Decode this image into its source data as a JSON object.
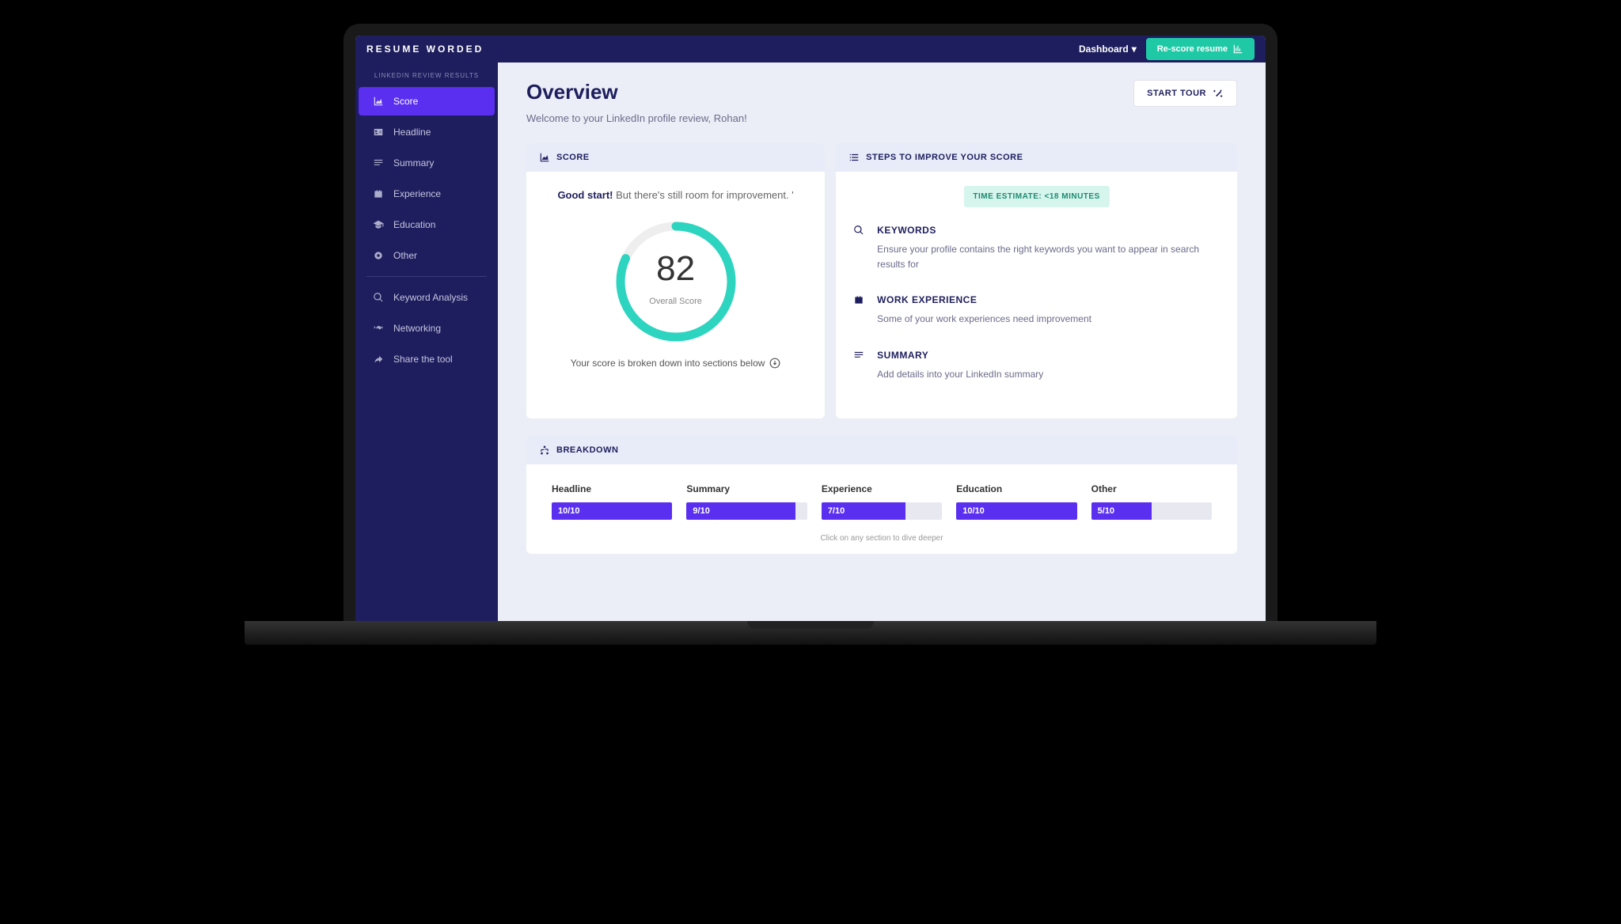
{
  "brand": "RESUME WORDED",
  "topbar": {
    "dashboard": "Dashboard",
    "rescore": "Re-score resume"
  },
  "sidebar": {
    "header": "LINKEDIN REVIEW RESULTS",
    "items": [
      {
        "label": "Score"
      },
      {
        "label": "Headline"
      },
      {
        "label": "Summary"
      },
      {
        "label": "Experience"
      },
      {
        "label": "Education"
      },
      {
        "label": "Other"
      }
    ],
    "tools": [
      {
        "label": "Keyword Analysis"
      },
      {
        "label": "Networking"
      },
      {
        "label": "Share the tool"
      }
    ]
  },
  "overview": {
    "title": "Overview",
    "welcome": "Welcome to your LinkedIn profile review, Rohan!",
    "start_tour": "START TOUR"
  },
  "score": {
    "header": "SCORE",
    "headline_bold": "Good start!",
    "headline_rest": " But there's still room for improvement. '",
    "value": "82",
    "label": "Overall Score",
    "footer": "Your score is broken down into sections below"
  },
  "steps": {
    "header": "STEPS TO IMPROVE YOUR SCORE",
    "time_estimate": "TIME ESTIMATE: <18 MINUTES",
    "items": [
      {
        "title": "KEYWORDS",
        "desc": "Ensure your profile contains the right keywords you want to appear in search results for"
      },
      {
        "title": "WORK EXPERIENCE",
        "desc": "Some of your work experiences need improvement"
      },
      {
        "title": "SUMMARY",
        "desc": "Add details into your LinkedIn summary"
      }
    ]
  },
  "breakdown": {
    "header": "BREAKDOWN",
    "footer": "Click on any section to dive deeper",
    "items": [
      {
        "label": "Headline",
        "score": "10/10",
        "pct": 100
      },
      {
        "label": "Summary",
        "score": "9/10",
        "pct": 90
      },
      {
        "label": "Experience",
        "score": "7/10",
        "pct": 70
      },
      {
        "label": "Education",
        "score": "10/10",
        "pct": 100
      },
      {
        "label": "Other",
        "score": "5/10",
        "pct": 50
      }
    ]
  },
  "chart_data": {
    "type": "bar",
    "title": "Breakdown",
    "categories": [
      "Headline",
      "Summary",
      "Experience",
      "Education",
      "Other"
    ],
    "values": [
      10,
      9,
      7,
      10,
      5
    ],
    "ylim": [
      0,
      10
    ],
    "overall_score": 82
  }
}
